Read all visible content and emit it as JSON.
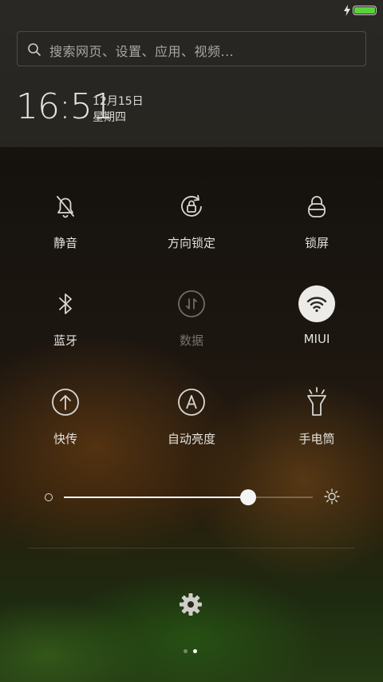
{
  "search": {
    "placeholder": "搜索网页、设置、应用、视频..."
  },
  "clock": {
    "time": "16:51",
    "date": "12月15日",
    "weekday": "星期四"
  },
  "toggles": [
    {
      "label": "静音",
      "icon": "bell-muted-icon",
      "enabled": true,
      "active": false
    },
    {
      "label": "方向锁定",
      "icon": "rotation-lock-icon",
      "enabled": true,
      "active": false
    },
    {
      "label": "锁屏",
      "icon": "lock-icon",
      "enabled": true,
      "active": false
    },
    {
      "label": "蓝牙",
      "icon": "bluetooth-icon",
      "enabled": true,
      "active": false
    },
    {
      "label": "数据",
      "icon": "mobile-data-icon",
      "enabled": false,
      "active": false
    },
    {
      "label": "MIUI",
      "icon": "wifi-icon",
      "enabled": true,
      "active": true
    },
    {
      "label": "快传",
      "icon": "quick-transfer-icon",
      "enabled": true,
      "active": false
    },
    {
      "label": "自动亮度",
      "icon": "auto-brightness-icon",
      "enabled": true,
      "active": false
    },
    {
      "label": "手电筒",
      "icon": "flashlight-icon",
      "enabled": true,
      "active": false
    }
  ],
  "brightness": {
    "level": 0.74
  },
  "pager": {
    "count": 2,
    "current": 1
  },
  "colors": {
    "battery": "#5ad23a",
    "active_toggle_bg": "#ecebe8",
    "disabled_label": "#77736d"
  }
}
